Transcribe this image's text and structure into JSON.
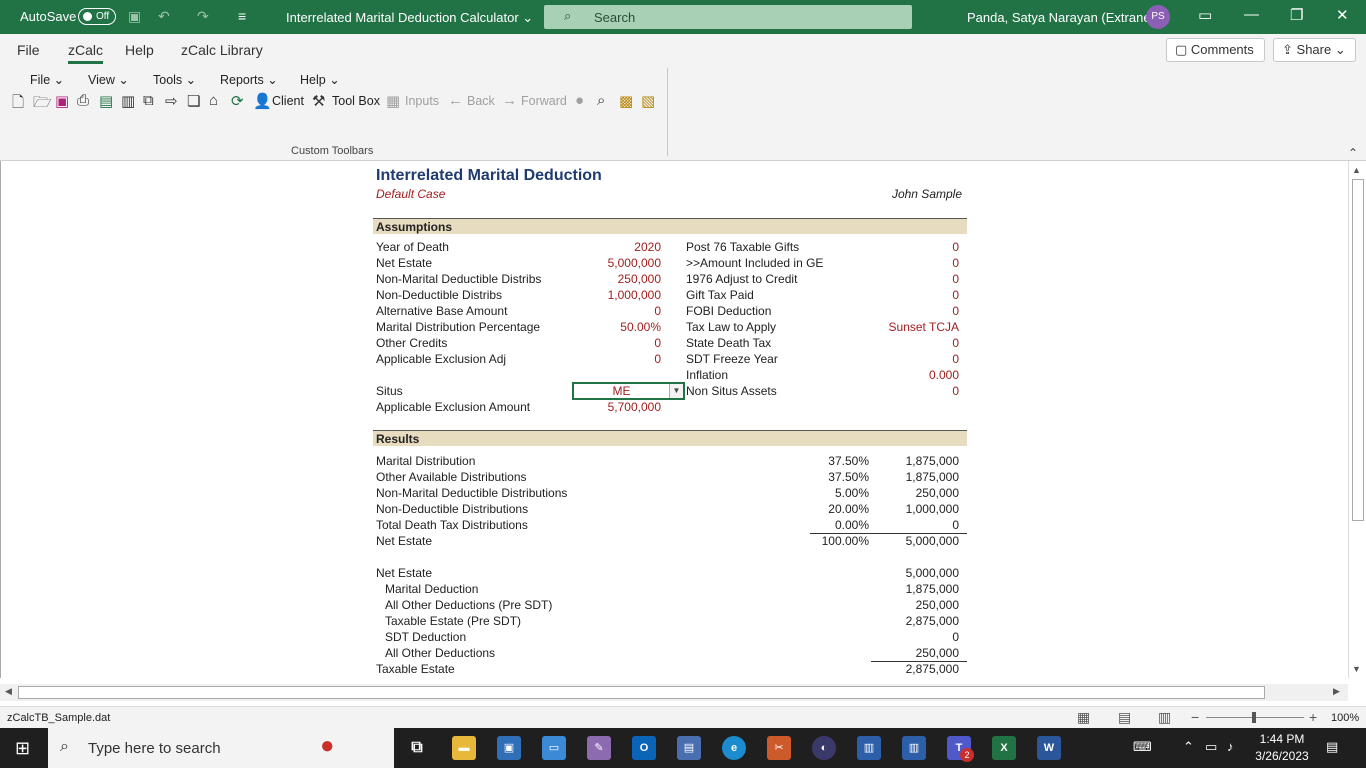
{
  "titlebar": {
    "autosave_label": "AutoSave",
    "autosave_state": "Off",
    "doc_title": "Interrelated Marital Deduction Calculator",
    "search_placeholder": "Search",
    "user_name": "Panda, Satya Narayan (Extranet)",
    "user_initials": "PS"
  },
  "ribbon": {
    "tabs": [
      "File",
      "zCalc",
      "Help",
      "zCalc Library"
    ],
    "active_tab": "zCalc",
    "comments_label": "Comments",
    "share_label": "Share",
    "menus": [
      "File",
      "View",
      "Tools",
      "Reports",
      "Help"
    ],
    "toolbar": {
      "client": "Client",
      "toolbox": "Tool Box",
      "inputs": "Inputs",
      "back": "Back",
      "forward": "Forward"
    },
    "group_label": "Custom Toolbars"
  },
  "sheet": {
    "title": "Interrelated Marital Deduction",
    "case_name": "Default Case",
    "client_name": "John Sample",
    "assumptions_header": "Assumptions",
    "assumptions_left": [
      {
        "label": "Year of Death",
        "value": "2020"
      },
      {
        "label": "Net Estate",
        "value": "5,000,000"
      },
      {
        "label": "Non-Marital Deductible Distribs",
        "value": "250,000"
      },
      {
        "label": "Non-Deductible Distribs",
        "value": "1,000,000"
      },
      {
        "label": "Alternative Base Amount",
        "value": "0"
      },
      {
        "label": "Marital Distribution Percentage",
        "value": "50.00%"
      },
      {
        "label": "Other Credits",
        "value": "0"
      },
      {
        "label": "Applicable Exclusion Adj",
        "value": "0"
      }
    ],
    "assumptions_right": [
      {
        "label": "Post 76 Taxable Gifts",
        "value": "0"
      },
      {
        "label": ">>Amount Included in GE",
        "value": "0"
      },
      {
        "label": "1976 Adjust to Credit",
        "value": "0"
      },
      {
        "label": "Gift Tax Paid",
        "value": "0"
      },
      {
        "label": "FOBI Deduction",
        "value": "0"
      },
      {
        "label": "Tax Law to Apply",
        "value": "Sunset TCJA"
      },
      {
        "label": "State Death Tax",
        "value": "0"
      },
      {
        "label": "SDT Freeze Year",
        "value": "0"
      },
      {
        "label": "Inflation",
        "value": "0.000"
      },
      {
        "label": "Non Situs Assets",
        "value": "0"
      }
    ],
    "situs_label": "Situs",
    "situs_value": "ME",
    "aea_label": "Applicable Exclusion Amount",
    "aea_value": "5,700,000",
    "results_header": "Results",
    "results": [
      {
        "label": "Marital Distribution",
        "pct": "37.50%",
        "amount": "1,875,000"
      },
      {
        "label": "Other Available Distributions",
        "pct": "37.50%",
        "amount": "1,875,000"
      },
      {
        "label": "Non-Marital Deductible Distributions",
        "pct": "5.00%",
        "amount": "250,000"
      },
      {
        "label": "Non-Deductible Distributions",
        "pct": "20.00%",
        "amount": "1,000,000"
      },
      {
        "label": "Total Death Tax Distributions",
        "pct": "0.00%",
        "amount": "0"
      },
      {
        "label": "Net Estate",
        "pct": "100.00%",
        "amount": "5,000,000"
      }
    ],
    "estate": [
      {
        "label": "Net Estate",
        "amount": "5,000,000",
        "indent": false
      },
      {
        "label": "Marital Deduction",
        "amount": "1,875,000",
        "indent": true
      },
      {
        "label": "All Other Deductions (Pre SDT)",
        "amount": "250,000",
        "indent": true
      },
      {
        "label": "Taxable Estate (Pre SDT)",
        "amount": "2,875,000",
        "indent": true
      },
      {
        "label": "SDT Deduction",
        "amount": "0",
        "indent": true
      },
      {
        "label": "All Other Deductions",
        "amount": "250,000",
        "indent": true
      },
      {
        "label": "Taxable Estate",
        "amount": "2,875,000",
        "indent": false
      }
    ]
  },
  "statusbar": {
    "filename": "zCalcTB_Sample.dat",
    "zoom": "100%"
  },
  "taskbar": {
    "search_placeholder": "Type here to search",
    "time": "1:44 PM",
    "date": "3/26/2023",
    "teams_badge": "2"
  },
  "colors": {
    "excel_green": "#217346",
    "input_red": "#a0201f",
    "section_header_bg": "#e8dcc0",
    "title_blue": "#1f3b6f"
  }
}
